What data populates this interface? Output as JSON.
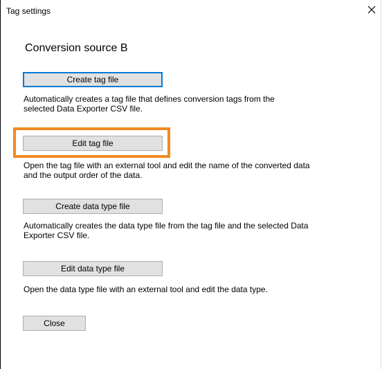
{
  "window": {
    "title": "Tag settings",
    "close_icon": "close-icon"
  },
  "heading": "Conversion source B",
  "sections": [
    {
      "button_label": "Create tag file",
      "description_lines": [
        "Automatically creates a tag file that defines conversion tags from the",
        "selected Data Exporter CSV file."
      ]
    },
    {
      "button_label": "Edit tag file",
      "description_lines": [
        "Open the tag file with an external tool and edit the name of the converted data",
        "and the output order of the data."
      ]
    },
    {
      "button_label": "Create data type file",
      "description_lines": [
        "Automatically creates the data type file from the tag file and the selected Data",
        "Exporter CSV file."
      ]
    },
    {
      "button_label": "Edit data type file",
      "description_lines": [
        "Open the data type file with an external tool and edit the data type."
      ]
    }
  ],
  "close_button_label": "Close",
  "colors": {
    "highlight": "#f28a23",
    "focus_border": "#0078d7",
    "button_face": "#e1e1e1"
  }
}
